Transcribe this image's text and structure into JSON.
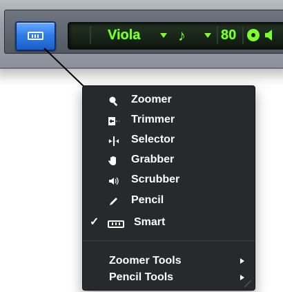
{
  "toolbar": {
    "instrument": "Viola",
    "tempo": "80"
  },
  "menu": {
    "items": [
      {
        "label": "Zoomer",
        "icon": "zoomer-icon"
      },
      {
        "label": "Trimmer",
        "icon": "trimmer-icon"
      },
      {
        "label": "Selector",
        "icon": "selector-icon"
      },
      {
        "label": "Grabber",
        "icon": "grabber-hand-icon"
      },
      {
        "label": "Scrubber",
        "icon": "scrubber-speaker-icon"
      },
      {
        "label": "Pencil",
        "icon": "pencil-icon"
      },
      {
        "label": "Smart",
        "icon": "smart-tool-icon",
        "checked": true
      }
    ],
    "checkmark": "✓",
    "submenus": [
      {
        "label": "Zoomer Tools"
      },
      {
        "label": "Pencil Tools"
      }
    ]
  },
  "colors": {
    "lcd_text": "#7dff2f",
    "smart_button_blue": "#2f7ee8",
    "menu_bg": "#1e2024"
  }
}
